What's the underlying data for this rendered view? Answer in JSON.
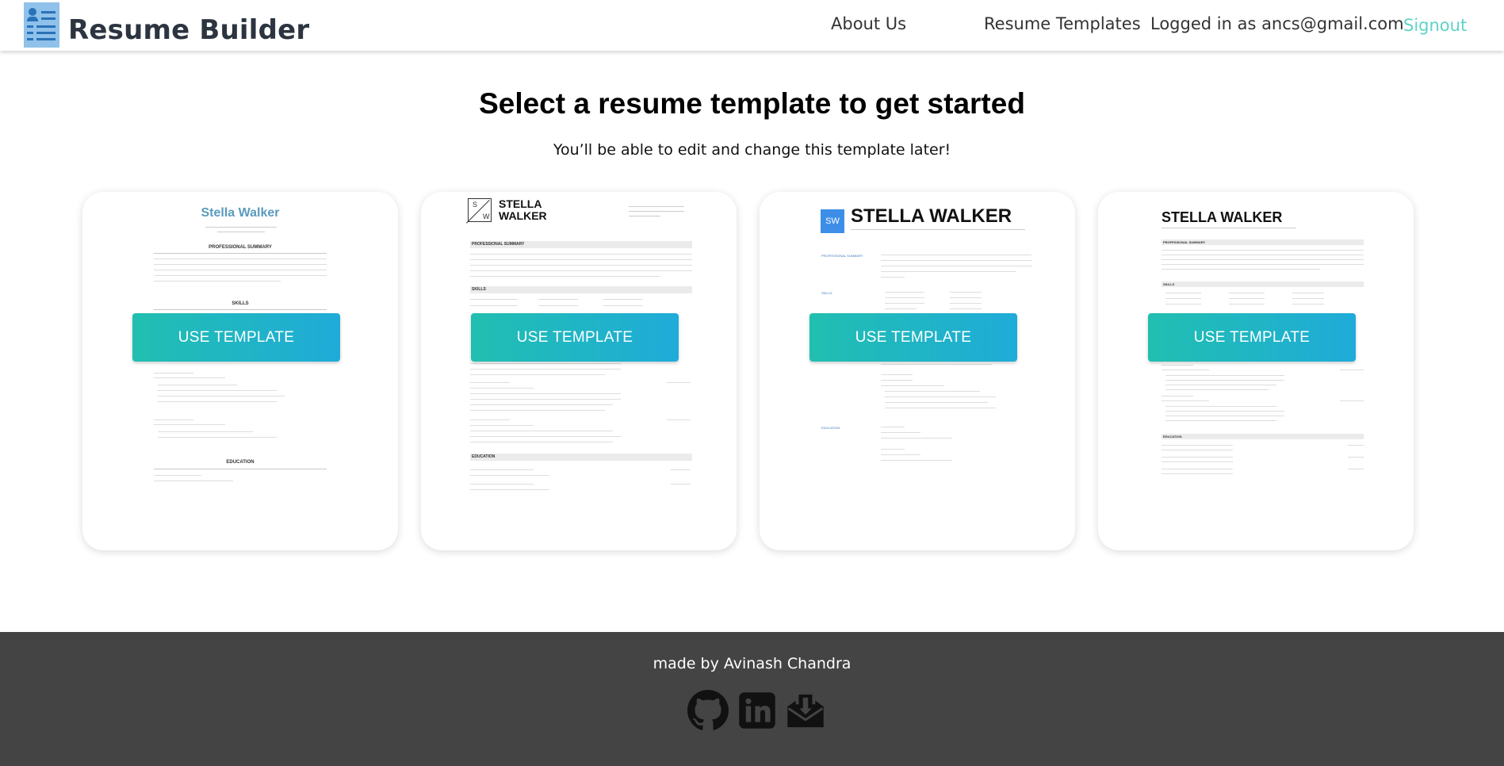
{
  "header": {
    "brand": "Resume Builder",
    "nav": {
      "about": "About Us",
      "templates": "Resume Templates",
      "logged_in": "Logged in as ancs@gmail.com",
      "signout": "Signout"
    }
  },
  "hero": {
    "title": "Select a resume template to get started",
    "subtitle": "You’ll be able to edit and change this template later!"
  },
  "templates": [
    {
      "name": "Stella Walker",
      "button": "USE TEMPLATE",
      "sections": [
        "PROFESSIONAL SUMMARY",
        "SKILLS",
        "EDUCATION"
      ]
    },
    {
      "name_line1": "STELLA",
      "name_line2": "WALKER",
      "monogram_top": "S",
      "monogram_bottom": "W",
      "button": "USE TEMPLATE",
      "sections": [
        "PROFESSIONAL SUMMARY",
        "SKILLS",
        "EDUCATION"
      ]
    },
    {
      "name": "STELLA WALKER",
      "monogram": "SW",
      "button": "USE TEMPLATE",
      "sections": [
        "PROFESSIONAL SUMMARY",
        "SKILLS",
        "EDUCATION"
      ]
    },
    {
      "name": "STELLA WALKER",
      "button": "USE TEMPLATE",
      "sections": [
        "PROFESSIONAL SUMMARY",
        "SKILLS",
        "EDUCATION"
      ]
    }
  ],
  "footer": {
    "credit": "made by Avinash Chandra",
    "icons": [
      "github-icon",
      "linkedin-icon",
      "mail-icon"
    ]
  },
  "colors": {
    "accent": "#5fd3c6",
    "button_start": "#21bfb0",
    "button_end": "#1fabd9",
    "footer_bg": "#444444",
    "template1_name": "#5b9bbd",
    "template3_badge": "#3d8ee8"
  }
}
